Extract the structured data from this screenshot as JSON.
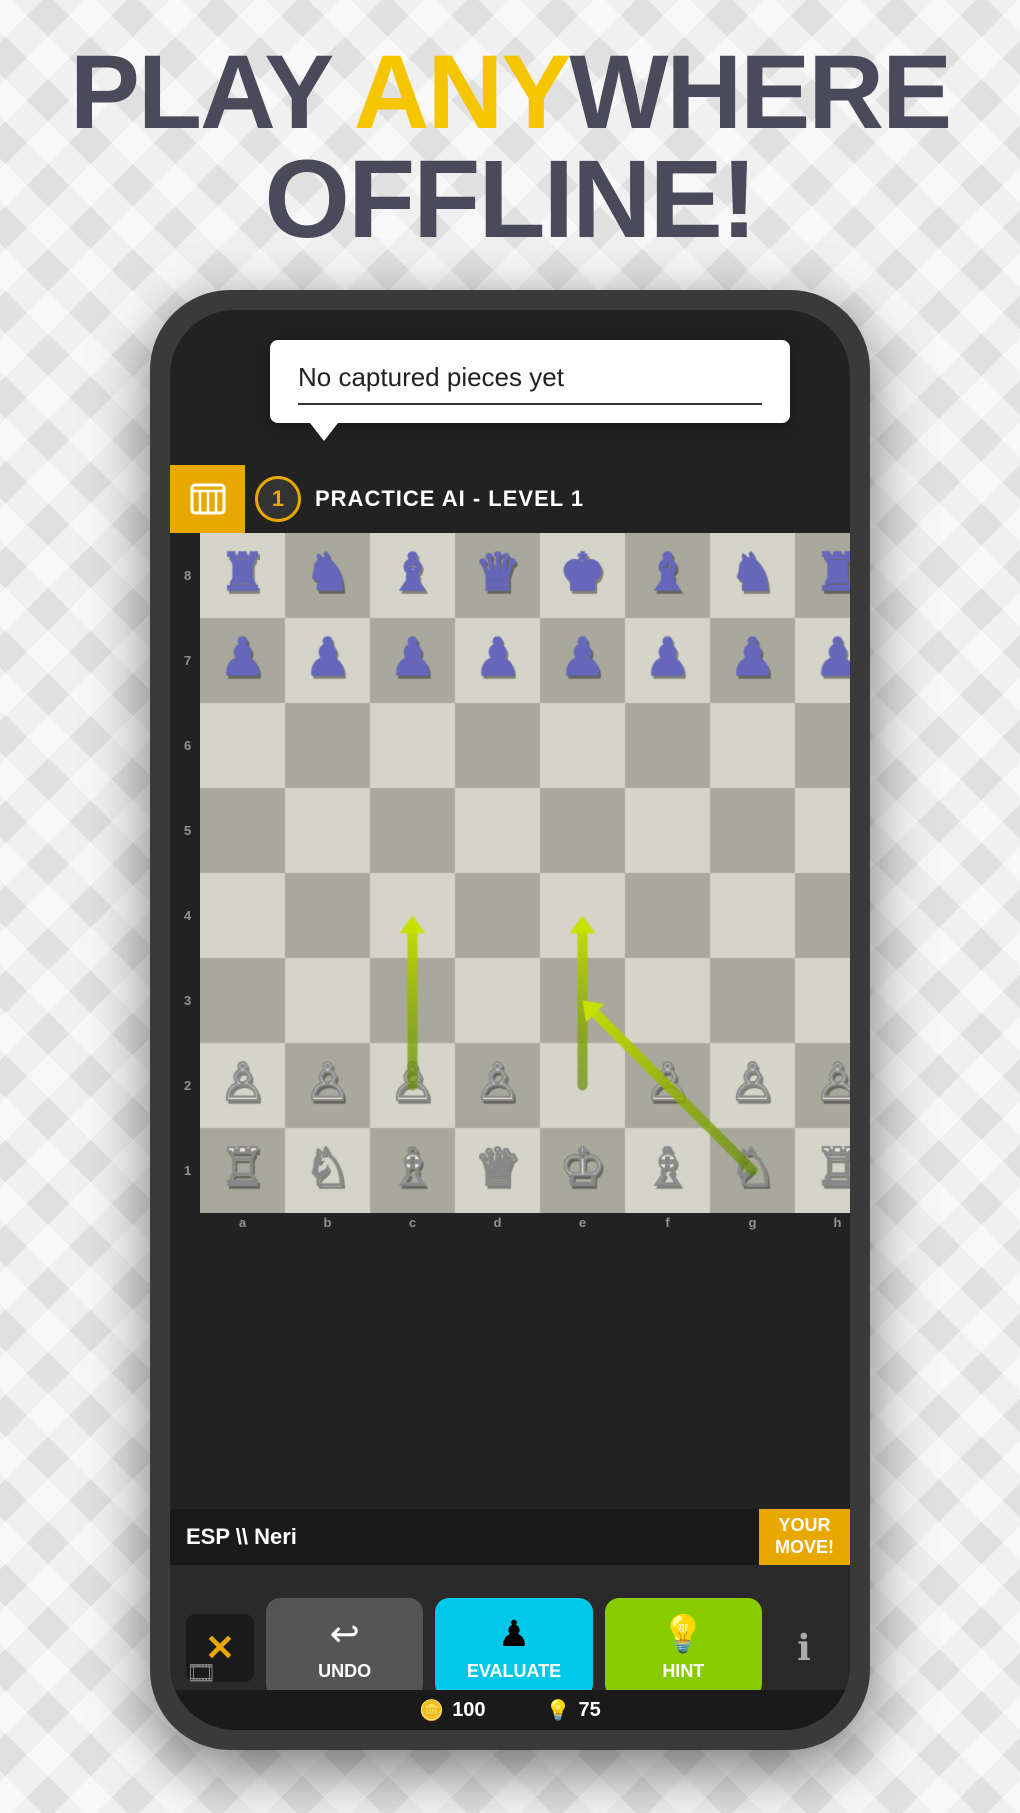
{
  "headline": {
    "line1": "PLAY ANYWHERE",
    "line2": "OFFLINE!",
    "line1_yellow": "ANY"
  },
  "tooltip": {
    "text": "No captured pieces yet"
  },
  "header": {
    "level": "1",
    "title": "PRACTICE AI - LEVEL 1"
  },
  "player": {
    "name": "ESP \\\\ Neri",
    "your_move": "YOUR\nMOVE!"
  },
  "buttons": {
    "close": "✕",
    "undo_label": "UNDO",
    "evaluate_label": "EVALUATE",
    "hint_label": "HINT"
  },
  "stats": {
    "coins": "100",
    "hints": "75"
  },
  "board": {
    "rows": 8,
    "cols": 8,
    "col_labels": [
      "a",
      "b",
      "c",
      "d",
      "e",
      "f",
      "g",
      "h"
    ],
    "row_labels": [
      "8",
      "7",
      "6",
      "5",
      "4",
      "3",
      "2",
      "1"
    ],
    "pieces": [
      {
        "row": 0,
        "col": 0,
        "type": "rook",
        "color": "black"
      },
      {
        "row": 0,
        "col": 1,
        "type": "knight",
        "color": "black"
      },
      {
        "row": 0,
        "col": 2,
        "type": "bishop",
        "color": "black"
      },
      {
        "row": 0,
        "col": 3,
        "type": "queen",
        "color": "black"
      },
      {
        "row": 0,
        "col": 4,
        "type": "king",
        "color": "black"
      },
      {
        "row": 0,
        "col": 5,
        "type": "bishop",
        "color": "black"
      },
      {
        "row": 0,
        "col": 6,
        "type": "knight",
        "color": "black"
      },
      {
        "row": 0,
        "col": 7,
        "type": "rook",
        "color": "black"
      },
      {
        "row": 1,
        "col": 0,
        "type": "pawn",
        "color": "black"
      },
      {
        "row": 1,
        "col": 1,
        "type": "pawn",
        "color": "black"
      },
      {
        "row": 1,
        "col": 2,
        "type": "pawn",
        "color": "black"
      },
      {
        "row": 1,
        "col": 3,
        "type": "pawn",
        "color": "black"
      },
      {
        "row": 1,
        "col": 4,
        "type": "pawn",
        "color": "black"
      },
      {
        "row": 1,
        "col": 5,
        "type": "pawn",
        "color": "black"
      },
      {
        "row": 1,
        "col": 6,
        "type": "pawn",
        "color": "black"
      },
      {
        "row": 1,
        "col": 7,
        "type": "pawn",
        "color": "black"
      },
      {
        "row": 6,
        "col": 0,
        "type": "pawn",
        "color": "white"
      },
      {
        "row": 6,
        "col": 1,
        "type": "pawn",
        "color": "white"
      },
      {
        "row": 6,
        "col": 2,
        "type": "pawn",
        "color": "white"
      },
      {
        "row": 6,
        "col": 3,
        "type": "pawn",
        "color": "white"
      },
      {
        "row": 6,
        "col": 5,
        "type": "pawn",
        "color": "white"
      },
      {
        "row": 6,
        "col": 6,
        "type": "pawn",
        "color": "white"
      },
      {
        "row": 6,
        "col": 7,
        "type": "pawn",
        "color": "white"
      },
      {
        "row": 7,
        "col": 0,
        "type": "rook",
        "color": "white"
      },
      {
        "row": 7,
        "col": 1,
        "type": "knight",
        "color": "white"
      },
      {
        "row": 7,
        "col": 2,
        "type": "bishop",
        "color": "white"
      },
      {
        "row": 7,
        "col": 3,
        "type": "queen",
        "color": "white"
      },
      {
        "row": 7,
        "col": 4,
        "type": "king",
        "color": "white"
      },
      {
        "row": 7,
        "col": 5,
        "type": "bishop",
        "color": "white"
      },
      {
        "row": 7,
        "col": 6,
        "type": "knight",
        "color": "white"
      },
      {
        "row": 7,
        "col": 7,
        "type": "rook",
        "color": "white"
      }
    ],
    "arrows": [
      {
        "fromRow": 6,
        "fromCol": 2,
        "toRow": 4,
        "toCol": 2
      },
      {
        "fromRow": 6,
        "fromCol": 4,
        "toRow": 4,
        "toCol": 4
      },
      {
        "fromRow": 7,
        "fromCol": 6,
        "toRow": 5,
        "toCol": 4
      }
    ]
  }
}
